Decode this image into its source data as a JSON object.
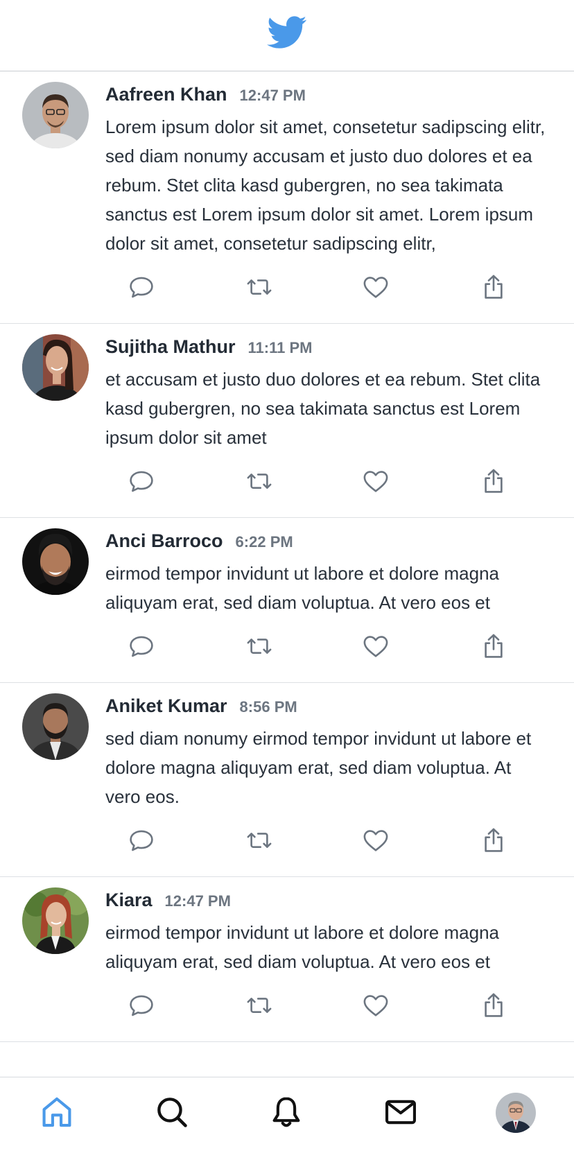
{
  "app": {
    "logo_icon": "twitter-bird-icon",
    "brand_color": "#4a99e9"
  },
  "tweets": [
    {
      "name": "Aafreen Khan",
      "time": "12:47 PM",
      "text": "Lorem ipsum dolor sit amet, consetetur sadipscing elitr, sed diam nonumy accusam et justo duo dolores et ea rebum. Stet clita kasd gubergren, no sea takimata sanctus est Lorem ipsum dolor sit amet. Lorem ipsum dolor sit amet, consetetur sadipscing elitr,",
      "avatar_colors": {
        "bg": "#b8bcc0",
        "skin": "#c89a7c",
        "hair": "#3b2a20",
        "shirt": "#e8e8e8"
      }
    },
    {
      "name": "Sujitha Mathur",
      "time": "11:11 PM",
      "text": " et accusam et justo duo dolores et ea rebum. Stet clita kasd gubergren, no sea takimata sanctus est Lorem ipsum dolor sit amet",
      "avatar_colors": {
        "bg": "#8a4a3c",
        "skin": "#d9a98c",
        "hair": "#2a1a14",
        "shirt": "#1c1c1c"
      }
    },
    {
      "name": "Anci Barroco",
      "time": "6:22 PM",
      "text": "eirmod tempor invidunt ut labore et dolore magna aliquyam erat, sed diam voluptua. At vero eos et",
      "avatar_colors": {
        "bg": "#111111",
        "skin": "#b07a5a",
        "hair": "#1a1a1a",
        "shirt": "#0c0c0c"
      }
    },
    {
      "name": "Aniket Kumar",
      "time": "8:56 PM",
      "text": "sed diam nonumy eirmod tempor invidunt ut labore et dolore magna aliquyam erat, sed diam voluptua. At vero eos.",
      "avatar_colors": {
        "bg": "#4a4a4a",
        "skin": "#a8785c",
        "hair": "#1e1a18",
        "shirt": "#2c2c2c"
      }
    },
    {
      "name": "Kiara",
      "time": "12:47 PM",
      "text": "eirmod tempor invidunt ut labore et dolore magna aliquyam erat, sed diam voluptua. At vero eos et",
      "avatar_colors": {
        "bg": "#6f8f4a",
        "skin": "#e2b99c",
        "hair": "#a8432a",
        "shirt": "#1a1a1a"
      }
    }
  ],
  "tweet_actions": [
    "reply-icon",
    "retweet-icon",
    "like-icon",
    "share-icon"
  ],
  "bottom_nav": {
    "items": [
      "home-icon",
      "search-icon",
      "notifications-icon",
      "messages-icon",
      "profile-avatar"
    ],
    "active": "home-icon",
    "active_color": "#4a99e9",
    "inactive_color": "#111111"
  }
}
